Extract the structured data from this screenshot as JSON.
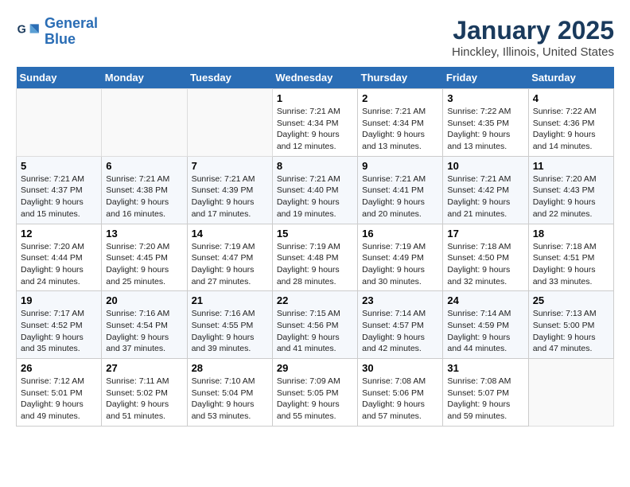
{
  "header": {
    "logo_text_general": "General",
    "logo_text_blue": "Blue",
    "title": "January 2025",
    "subtitle": "Hinckley, Illinois, United States"
  },
  "days_of_week": [
    "Sunday",
    "Monday",
    "Tuesday",
    "Wednesday",
    "Thursday",
    "Friday",
    "Saturday"
  ],
  "weeks": [
    [
      {
        "day": "",
        "info": ""
      },
      {
        "day": "",
        "info": ""
      },
      {
        "day": "",
        "info": ""
      },
      {
        "day": "1",
        "info": "Sunrise: 7:21 AM\nSunset: 4:34 PM\nDaylight: 9 hours\nand 12 minutes."
      },
      {
        "day": "2",
        "info": "Sunrise: 7:21 AM\nSunset: 4:34 PM\nDaylight: 9 hours\nand 13 minutes."
      },
      {
        "day": "3",
        "info": "Sunrise: 7:22 AM\nSunset: 4:35 PM\nDaylight: 9 hours\nand 13 minutes."
      },
      {
        "day": "4",
        "info": "Sunrise: 7:22 AM\nSunset: 4:36 PM\nDaylight: 9 hours\nand 14 minutes."
      }
    ],
    [
      {
        "day": "5",
        "info": "Sunrise: 7:21 AM\nSunset: 4:37 PM\nDaylight: 9 hours\nand 15 minutes."
      },
      {
        "day": "6",
        "info": "Sunrise: 7:21 AM\nSunset: 4:38 PM\nDaylight: 9 hours\nand 16 minutes."
      },
      {
        "day": "7",
        "info": "Sunrise: 7:21 AM\nSunset: 4:39 PM\nDaylight: 9 hours\nand 17 minutes."
      },
      {
        "day": "8",
        "info": "Sunrise: 7:21 AM\nSunset: 4:40 PM\nDaylight: 9 hours\nand 19 minutes."
      },
      {
        "day": "9",
        "info": "Sunrise: 7:21 AM\nSunset: 4:41 PM\nDaylight: 9 hours\nand 20 minutes."
      },
      {
        "day": "10",
        "info": "Sunrise: 7:21 AM\nSunset: 4:42 PM\nDaylight: 9 hours\nand 21 minutes."
      },
      {
        "day": "11",
        "info": "Sunrise: 7:20 AM\nSunset: 4:43 PM\nDaylight: 9 hours\nand 22 minutes."
      }
    ],
    [
      {
        "day": "12",
        "info": "Sunrise: 7:20 AM\nSunset: 4:44 PM\nDaylight: 9 hours\nand 24 minutes."
      },
      {
        "day": "13",
        "info": "Sunrise: 7:20 AM\nSunset: 4:45 PM\nDaylight: 9 hours\nand 25 minutes."
      },
      {
        "day": "14",
        "info": "Sunrise: 7:19 AM\nSunset: 4:47 PM\nDaylight: 9 hours\nand 27 minutes."
      },
      {
        "day": "15",
        "info": "Sunrise: 7:19 AM\nSunset: 4:48 PM\nDaylight: 9 hours\nand 28 minutes."
      },
      {
        "day": "16",
        "info": "Sunrise: 7:19 AM\nSunset: 4:49 PM\nDaylight: 9 hours\nand 30 minutes."
      },
      {
        "day": "17",
        "info": "Sunrise: 7:18 AM\nSunset: 4:50 PM\nDaylight: 9 hours\nand 32 minutes."
      },
      {
        "day": "18",
        "info": "Sunrise: 7:18 AM\nSunset: 4:51 PM\nDaylight: 9 hours\nand 33 minutes."
      }
    ],
    [
      {
        "day": "19",
        "info": "Sunrise: 7:17 AM\nSunset: 4:52 PM\nDaylight: 9 hours\nand 35 minutes."
      },
      {
        "day": "20",
        "info": "Sunrise: 7:16 AM\nSunset: 4:54 PM\nDaylight: 9 hours\nand 37 minutes."
      },
      {
        "day": "21",
        "info": "Sunrise: 7:16 AM\nSunset: 4:55 PM\nDaylight: 9 hours\nand 39 minutes."
      },
      {
        "day": "22",
        "info": "Sunrise: 7:15 AM\nSunset: 4:56 PM\nDaylight: 9 hours\nand 41 minutes."
      },
      {
        "day": "23",
        "info": "Sunrise: 7:14 AM\nSunset: 4:57 PM\nDaylight: 9 hours\nand 42 minutes."
      },
      {
        "day": "24",
        "info": "Sunrise: 7:14 AM\nSunset: 4:59 PM\nDaylight: 9 hours\nand 44 minutes."
      },
      {
        "day": "25",
        "info": "Sunrise: 7:13 AM\nSunset: 5:00 PM\nDaylight: 9 hours\nand 47 minutes."
      }
    ],
    [
      {
        "day": "26",
        "info": "Sunrise: 7:12 AM\nSunset: 5:01 PM\nDaylight: 9 hours\nand 49 minutes."
      },
      {
        "day": "27",
        "info": "Sunrise: 7:11 AM\nSunset: 5:02 PM\nDaylight: 9 hours\nand 51 minutes."
      },
      {
        "day": "28",
        "info": "Sunrise: 7:10 AM\nSunset: 5:04 PM\nDaylight: 9 hours\nand 53 minutes."
      },
      {
        "day": "29",
        "info": "Sunrise: 7:09 AM\nSunset: 5:05 PM\nDaylight: 9 hours\nand 55 minutes."
      },
      {
        "day": "30",
        "info": "Sunrise: 7:08 AM\nSunset: 5:06 PM\nDaylight: 9 hours\nand 57 minutes."
      },
      {
        "day": "31",
        "info": "Sunrise: 7:08 AM\nSunset: 5:07 PM\nDaylight: 9 hours\nand 59 minutes."
      },
      {
        "day": "",
        "info": ""
      }
    ]
  ]
}
